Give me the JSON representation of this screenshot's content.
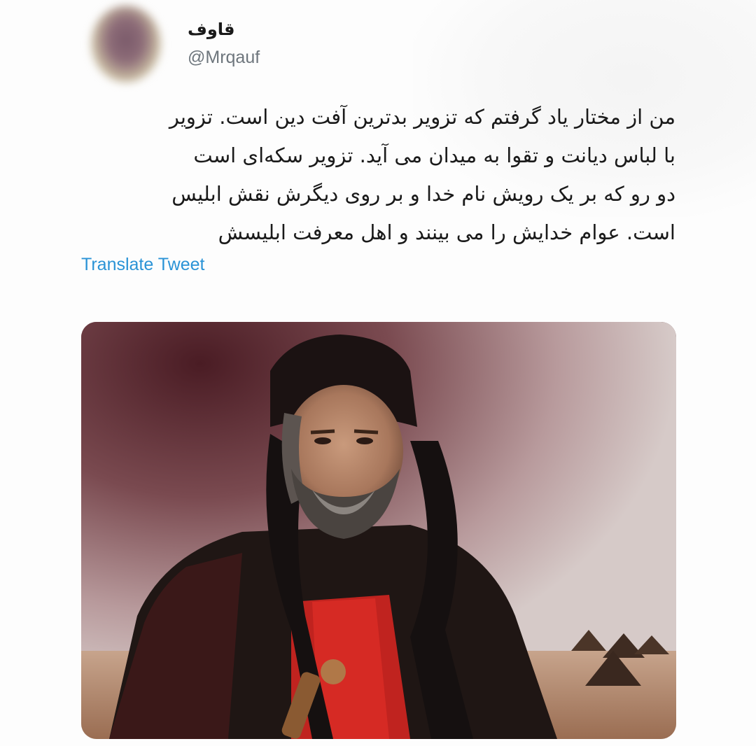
{
  "author": {
    "display_name": "قاوف",
    "handle": "@Mrqauf"
  },
  "tweet": {
    "lines": [
      "من از مختار یاد گرفتم که تزویر بدترین آفت دین است. تزویر",
      "با لباس دیانت و تقوا به میدان می آید. تزویر سکه‌ای است",
      "دو رو که بر یک رویش نام خدا و بر روی دیگرش نقش ابلیس",
      "است. عوام خدایش را می بینند و اهل معرفت ابلیسش"
    ],
    "translate_label": "Translate Tweet"
  },
  "media": {
    "description_icon": "photo-man-in-turban"
  },
  "colors": {
    "link": "#2a93d6",
    "handle": "#6e767d",
    "text": "#1a1a1a"
  }
}
